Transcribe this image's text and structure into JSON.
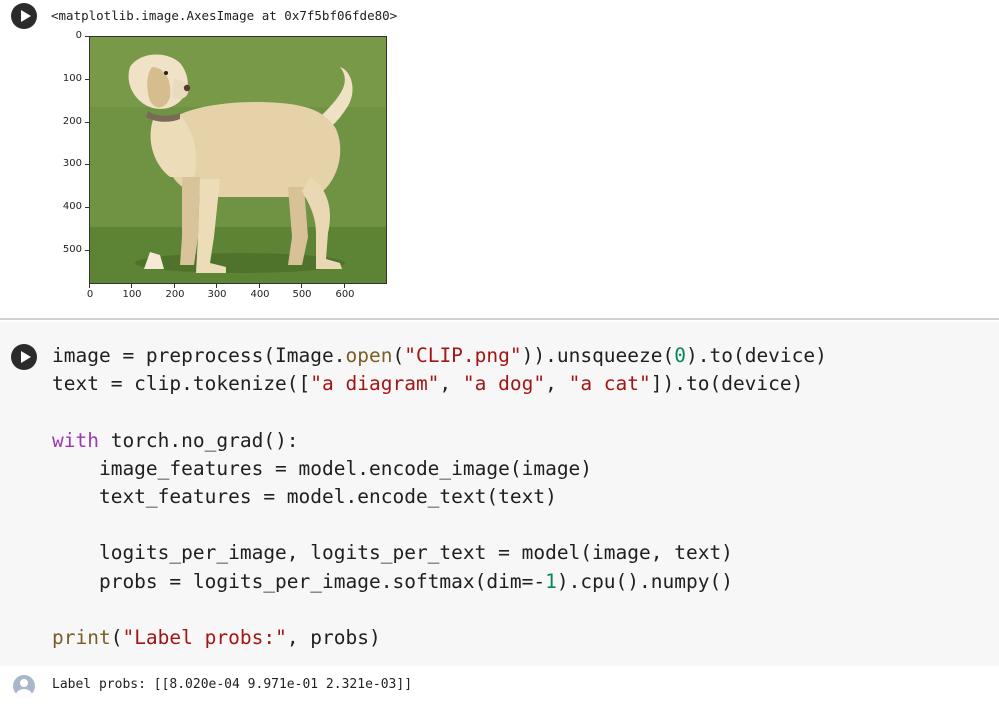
{
  "cell1": {
    "repr_text": "<matplotlib.image.AxesImage at 0x7f5bf06fde80>",
    "plot": {
      "image_description_icon": "labrador-dog-photo",
      "y_ticks": [
        "0",
        "100",
        "200",
        "300",
        "400",
        "500"
      ],
      "x_ticks": [
        "0",
        "100",
        "200",
        "300",
        "400",
        "500",
        "600"
      ]
    }
  },
  "cell2": {
    "code_lines": [
      "image = preprocess(Image.open(\"CLIP.png\")).unsqueeze(0).to(device)",
      "text = clip.tokenize([\"a diagram\", \"a dog\", \"a cat\"]).to(device)",
      "",
      "with torch.no_grad():",
      "    image_features = model.encode_image(image)",
      "    text_features = model.encode_text(text)",
      "",
      "    logits_per_image, logits_per_text = model(image, text)",
      "    probs = logits_per_image.softmax(dim=-1).cpu().numpy()",
      "",
      "print(\"Label probs:\", probs)"
    ]
  },
  "output": {
    "text": "Label probs: [[8.020e-04 9.971e-01 2.321e-03]]"
  },
  "colors": {
    "keyword": "#9a3bb0",
    "string": "#a31515",
    "number": "#098658",
    "code_bg": "#f7f7f7"
  }
}
